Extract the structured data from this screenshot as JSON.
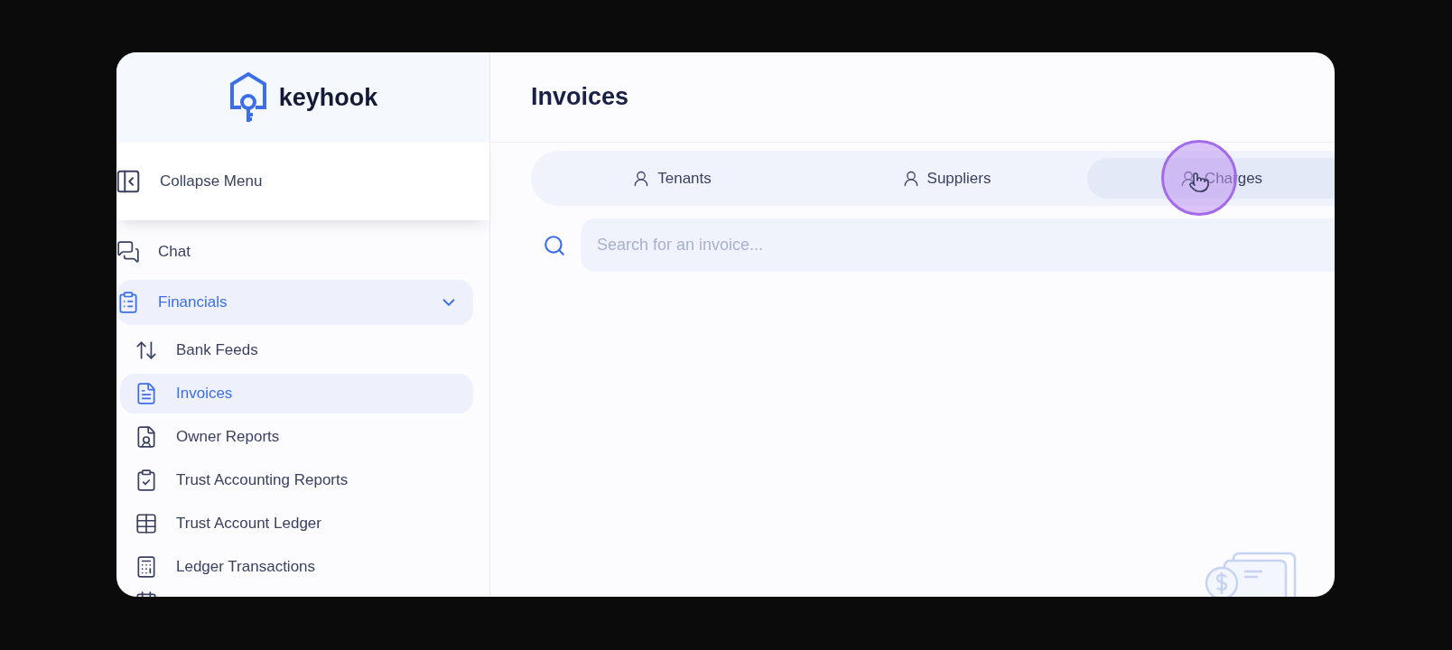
{
  "brand": {
    "name": "keyhook"
  },
  "sidebar": {
    "collapse_label": "Collapse Menu",
    "items": [
      {
        "kind": "chat",
        "label": "Chat",
        "selected": false
      },
      {
        "kind": "financials",
        "label": "Financials",
        "selected": true,
        "expanded": true,
        "children": [
          {
            "kind": "bank",
            "label": "Bank Feeds",
            "selected": false
          },
          {
            "kind": "invoice",
            "label": "Invoices",
            "selected": true
          },
          {
            "kind": "owner",
            "label": "Owner Reports",
            "selected": false
          },
          {
            "kind": "trust",
            "label": "Trust Accounting Reports",
            "selected": false
          },
          {
            "kind": "table",
            "label": "Trust Account Ledger",
            "selected": false
          },
          {
            "kind": "calc",
            "label": "Ledger Transactions",
            "selected": false
          }
        ]
      }
    ]
  },
  "page": {
    "title": "Invoices"
  },
  "tabs": [
    {
      "label": "Tenants",
      "selected": false
    },
    {
      "label": "Suppliers",
      "selected": false
    },
    {
      "label": "Charges",
      "selected": true
    }
  ],
  "search": {
    "placeholder": "Search for an invoice..."
  }
}
